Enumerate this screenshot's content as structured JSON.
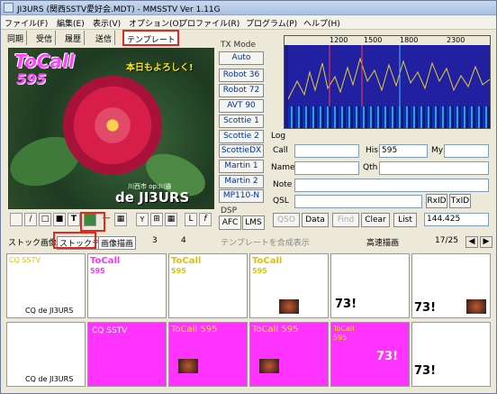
{
  "window": {
    "title": "JI3URS (関西SSTV愛好会.MDT) - MMSSTV Ver 1.11G"
  },
  "menu": [
    "ファイル(F)",
    "編集(E)",
    "表示(V)",
    "オプション(O)",
    "プロファイル(R)",
    "プログラム(P)",
    "ヘルプ(H)"
  ],
  "tabs": [
    "同期",
    "受信",
    "履歴",
    "送信",
    "テンプレート"
  ],
  "active_tab": "テンプレート",
  "image": {
    "tocall": "ToCall",
    "number": "595",
    "greeting": "本日もよろしく!",
    "location": "川西市 op:川邉",
    "signature": "de JI3URS"
  },
  "toolbar": {
    "tools": [
      "/",
      "□",
      "■",
      "T",
      "img",
      "—",
      "▦",
      "Y",
      "⊞",
      "▦",
      "L",
      "f"
    ]
  },
  "tx_mode": {
    "label": "TX Mode",
    "buttons": [
      "Auto",
      "Robot 36",
      "Robot 72",
      "AVT 90",
      "Scottie 1",
      "Scottie 2",
      "ScottieDX",
      "Martin 1",
      "Martin 2",
      "MP110-N"
    ]
  },
  "dsp": {
    "label": "DSP",
    "buttons": [
      "AFC",
      "LMS"
    ]
  },
  "spectrum": {
    "scale": [
      "1200",
      "1500",
      "1800",
      "2300"
    ]
  },
  "log": {
    "label": "Log",
    "call_label": "Call",
    "his_label": "His",
    "his_value": "595",
    "my_label": "My",
    "name_label": "Name",
    "qth_label": "Qth",
    "note_label": "Note",
    "qsl_label": "QSL",
    "rxid": "RxID",
    "txid": "TxID",
    "buttons": [
      "QSO",
      "Data",
      "Find",
      "Clear",
      "List"
    ],
    "freq": "144.425"
  },
  "bottom": {
    "stock_image": "ストック画像",
    "stock_template": "ストックテンプ",
    "image_draw": "画像描画",
    "page3": "3",
    "page4": "4",
    "composite": "テンプレートを合成表示",
    "fast_draw": "高速描画",
    "page_count": "17/25"
  },
  "thumbs": [
    {
      "title": "CQ SSTV",
      "sub": "CQ de JI3URS",
      "bg": "#ffffff",
      "tc": "#ffdd00",
      "big": ""
    },
    {
      "title": "ToCall",
      "sub": "595",
      "bg": "#ffffff",
      "tc": "#ff33ff",
      "big": ""
    },
    {
      "title": "ToCall",
      "sub": "595",
      "bg": "#ffffff",
      "tc": "#ffee00",
      "big": ""
    },
    {
      "title": "ToCall",
      "sub": "595",
      "bg": "#ffffff",
      "tc": "#ffee00",
      "big": ""
    },
    {
      "title": "",
      "sub": "",
      "bg": "#ffffff",
      "tc": "#000000",
      "big": "73!"
    },
    {
      "title": "",
      "sub": "",
      "bg": "#ffffff",
      "tc": "#000000",
      "big": "73!"
    },
    {
      "title": "",
      "sub": "CQ de JI3URS",
      "bg": "#ffffff",
      "tc": "#000000",
      "big": ""
    },
    {
      "title": "CQ SSTV",
      "sub": "",
      "bg": "#ff33ff",
      "tc": "#ffffff",
      "big": ""
    },
    {
      "title": "ToCall 595",
      "sub": "",
      "bg": "#ff33ff",
      "tc": "#ffee00",
      "big": ""
    },
    {
      "title": "ToCall 595",
      "sub": "",
      "bg": "#ff33ff",
      "tc": "#ffee00",
      "big": ""
    },
    {
      "title": "ToCall",
      "sub": "595",
      "bg": "#ff33ff",
      "tc": "#ffee00",
      "big": "73!"
    },
    {
      "title": "",
      "sub": "",
      "bg": "#ffffff",
      "tc": "#000000",
      "big": "73!"
    }
  ]
}
